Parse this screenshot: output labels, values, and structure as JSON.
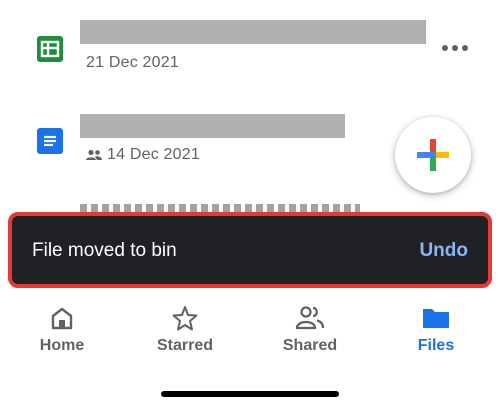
{
  "files": [
    {
      "type": "sheets",
      "date": "21 Dec 2021",
      "shared": false
    },
    {
      "type": "docs",
      "date": "14 Dec 2021",
      "shared": true
    }
  ],
  "snackbar": {
    "message": "File moved to bin",
    "action": "Undo"
  },
  "bottom_nav": {
    "items": [
      {
        "label": "Home",
        "icon": "home-icon",
        "active": false
      },
      {
        "label": "Starred",
        "icon": "star-icon",
        "active": false
      },
      {
        "label": "Shared",
        "icon": "people-icon",
        "active": false
      },
      {
        "label": "Files",
        "icon": "folder-icon",
        "active": true
      }
    ]
  },
  "colors": {
    "snackbar_bg": "#202124",
    "highlight_border": "#e53935",
    "accent": "#1a73e8",
    "undo": "#8ab4f8",
    "sheets": "#1e8e3e"
  }
}
